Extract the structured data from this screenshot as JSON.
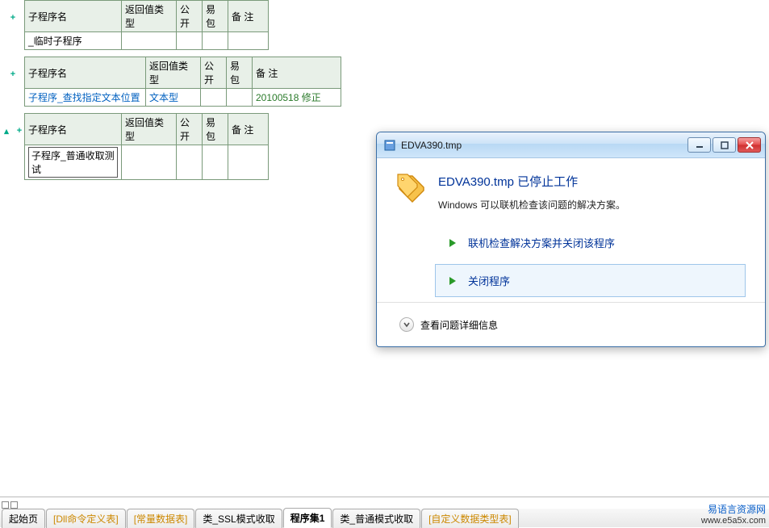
{
  "tables": {
    "headers": [
      "子程序名",
      "返回值类型",
      "公开",
      "易包",
      "备 注"
    ],
    "row1": {
      "name": "_临时子程序",
      "ret": "",
      "pub": "",
      "pkg": "",
      "note": ""
    },
    "row2": {
      "name": "子程序_查找指定文本位置",
      "ret": "文本型",
      "pub": "",
      "pkg": "",
      "note": "20100518 修正"
    },
    "row3": {
      "name": "子程序_普通收取测试",
      "ret": "",
      "pub": "",
      "pkg": "",
      "note": ""
    }
  },
  "dialog": {
    "windowTitle": "EDVA390.tmp",
    "title": "EDVA390.tmp 已停止工作",
    "subtitle": "Windows 可以联机检查该问题的解决方案。",
    "action1": "联机检查解决方案并关闭该程序",
    "action2": "关闭程序",
    "details": "查看问题详细信息"
  },
  "tabs": {
    "t1": "起始页",
    "t2": "[Dll命令定义表]",
    "t3": "[常量数据表]",
    "t4": "类_SSL模式收取",
    "t5": "程序集1",
    "t6": "类_普通模式收取",
    "t7": "[自定义数据类型表]"
  },
  "brand": {
    "cn": "易语言资源网",
    "url": "www.e5a5x.com"
  }
}
